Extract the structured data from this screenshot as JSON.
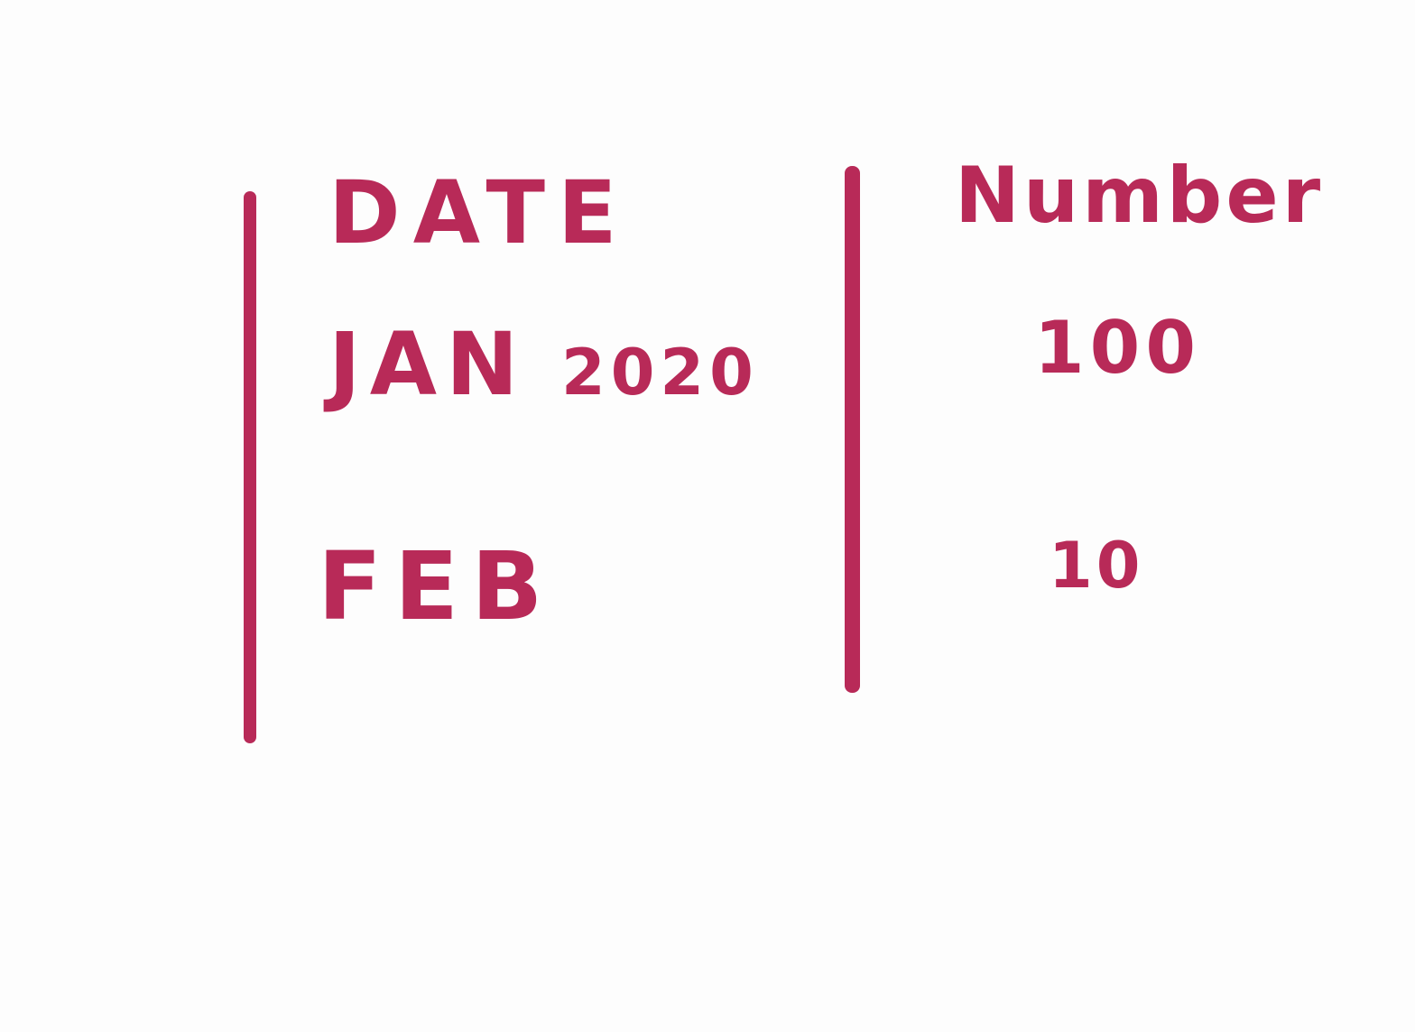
{
  "ink_color": "#b82a58",
  "table": {
    "headers": {
      "date": "DATE",
      "number": "Number"
    },
    "rows": [
      {
        "month": "JAN",
        "year": "2020",
        "number": "100"
      },
      {
        "month": "FEB",
        "year": "",
        "number": "10"
      }
    ]
  }
}
